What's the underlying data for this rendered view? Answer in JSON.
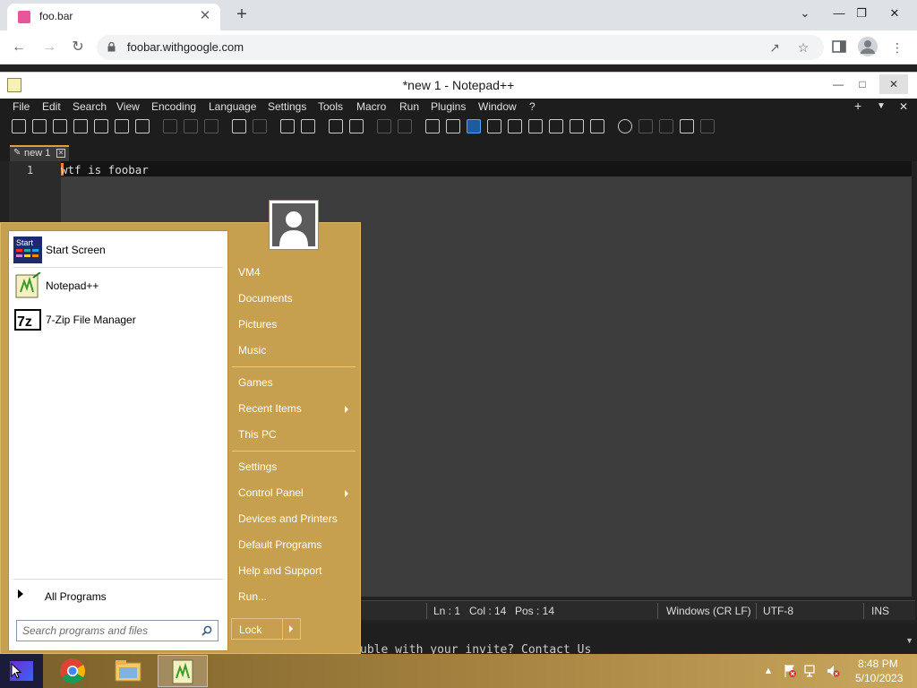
{
  "chrome": {
    "tab_title": "foo.bar",
    "tab_close": "✕",
    "new_tab": "+",
    "url": "foobar.withgoogle.com",
    "win_controls": [
      "⌄",
      "—",
      "❐",
      "✕"
    ]
  },
  "notepad": {
    "title": "*new 1 - Notepad++",
    "menu": [
      "File",
      "Edit",
      "Search",
      "View",
      "Encoding",
      "Language",
      "Settings",
      "Tools",
      "Macro",
      "Run",
      "Plugins",
      "Window",
      "?"
    ],
    "menu_right": [
      "+",
      "▼",
      "✕"
    ],
    "tab_label": "new 1",
    "line_number": "1",
    "line_text": "wtf is foobar",
    "status": {
      "ln": "Ln : 1",
      "col": "Col : 14",
      "pos": "Pos : 14",
      "eol": "Windows (CR LF)",
      "encoding": "UTF-8",
      "mode": "INS"
    }
  },
  "behind_text": "uble with your invite? Contact Us",
  "start_menu": {
    "left_items": [
      {
        "label": "Start Screen",
        "icon": "start-screen-icon"
      },
      {
        "label": "Notepad++",
        "icon": "notepadpp-icon"
      },
      {
        "label": "7-Zip File Manager",
        "icon": "7zip-icon"
      }
    ],
    "all_programs": "All Programs",
    "search_placeholder": "Search programs and files",
    "right_items": [
      "VM4",
      "Documents",
      "Pictures",
      "Music",
      "Games",
      "Recent Items",
      "This PC",
      "Settings",
      "Control Panel",
      "Devices and Printers",
      "Default Programs",
      "Help and Support",
      "Run..."
    ],
    "lock_label": "Lock"
  },
  "taskbar": {
    "time": "8:48 PM",
    "date": "5/10/2023",
    "tray_expand": "▲"
  }
}
